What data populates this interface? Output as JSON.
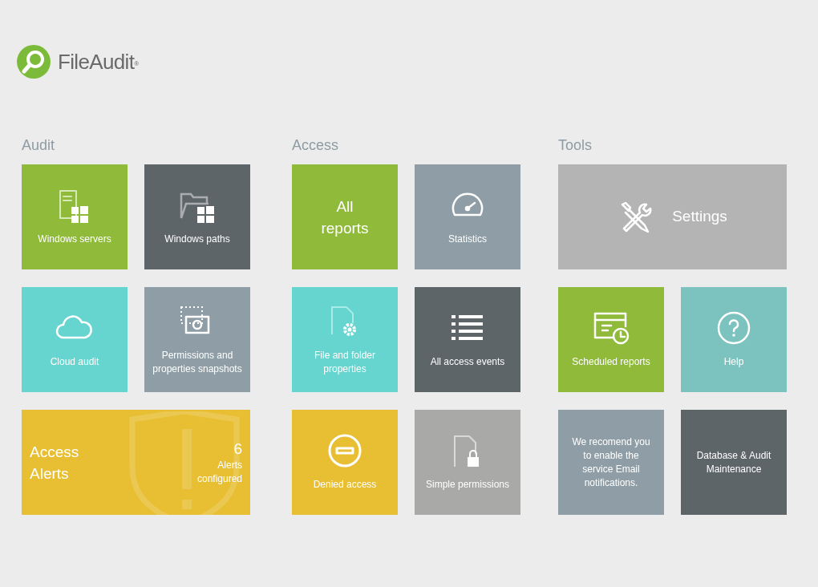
{
  "logo": {
    "name": "FileAudit",
    "mark": "®"
  },
  "sections": [
    {
      "title": "Audit",
      "tiles": [
        {
          "kind": "icon",
          "label": "Windows servers",
          "color": "#8fba3a"
        },
        {
          "kind": "icon",
          "label": "Windows paths",
          "color": "#5e6569"
        },
        {
          "kind": "icon",
          "label": "Cloud audit",
          "color": "#66d4cf"
        },
        {
          "kind": "icon",
          "label": "Permissions and properties snapshots",
          "color": "#8f9ea6"
        },
        {
          "kind": "alert",
          "label": "Access Alerts",
          "count": "6",
          "caption": "Alerts configured",
          "color": "#e8bf33"
        }
      ]
    },
    {
      "title": "Access",
      "tiles": [
        {
          "kind": "big",
          "label": "All reports",
          "color": "#8fba3a"
        },
        {
          "kind": "icon",
          "label": "Statistics",
          "color": "#8f9ea6"
        },
        {
          "kind": "icon",
          "label": "File and folder properties",
          "color": "#66d4cf"
        },
        {
          "kind": "icon",
          "label": "All access events",
          "color": "#5e6569"
        },
        {
          "kind": "icon",
          "label": "Denied access",
          "color": "#e8bf33"
        },
        {
          "kind": "icon",
          "label": "Simple permissions",
          "color": "#a9a9a7"
        }
      ]
    },
    {
      "title": "Tools",
      "tiles": [
        {
          "kind": "wide",
          "label": "Settings",
          "color": "#b4b4b4"
        },
        {
          "kind": "icon",
          "label": "Scheduled reports",
          "color": "#8fba3a"
        },
        {
          "kind": "icon",
          "label": "Help",
          "color": "#7cc3bf"
        },
        {
          "kind": "note",
          "label": "We recomend you to enable the service Email notifications.",
          "color": "#8f9ea6"
        },
        {
          "kind": "note",
          "label": "Database & Audit Maintenance",
          "color": "#5e6569"
        }
      ]
    }
  ]
}
